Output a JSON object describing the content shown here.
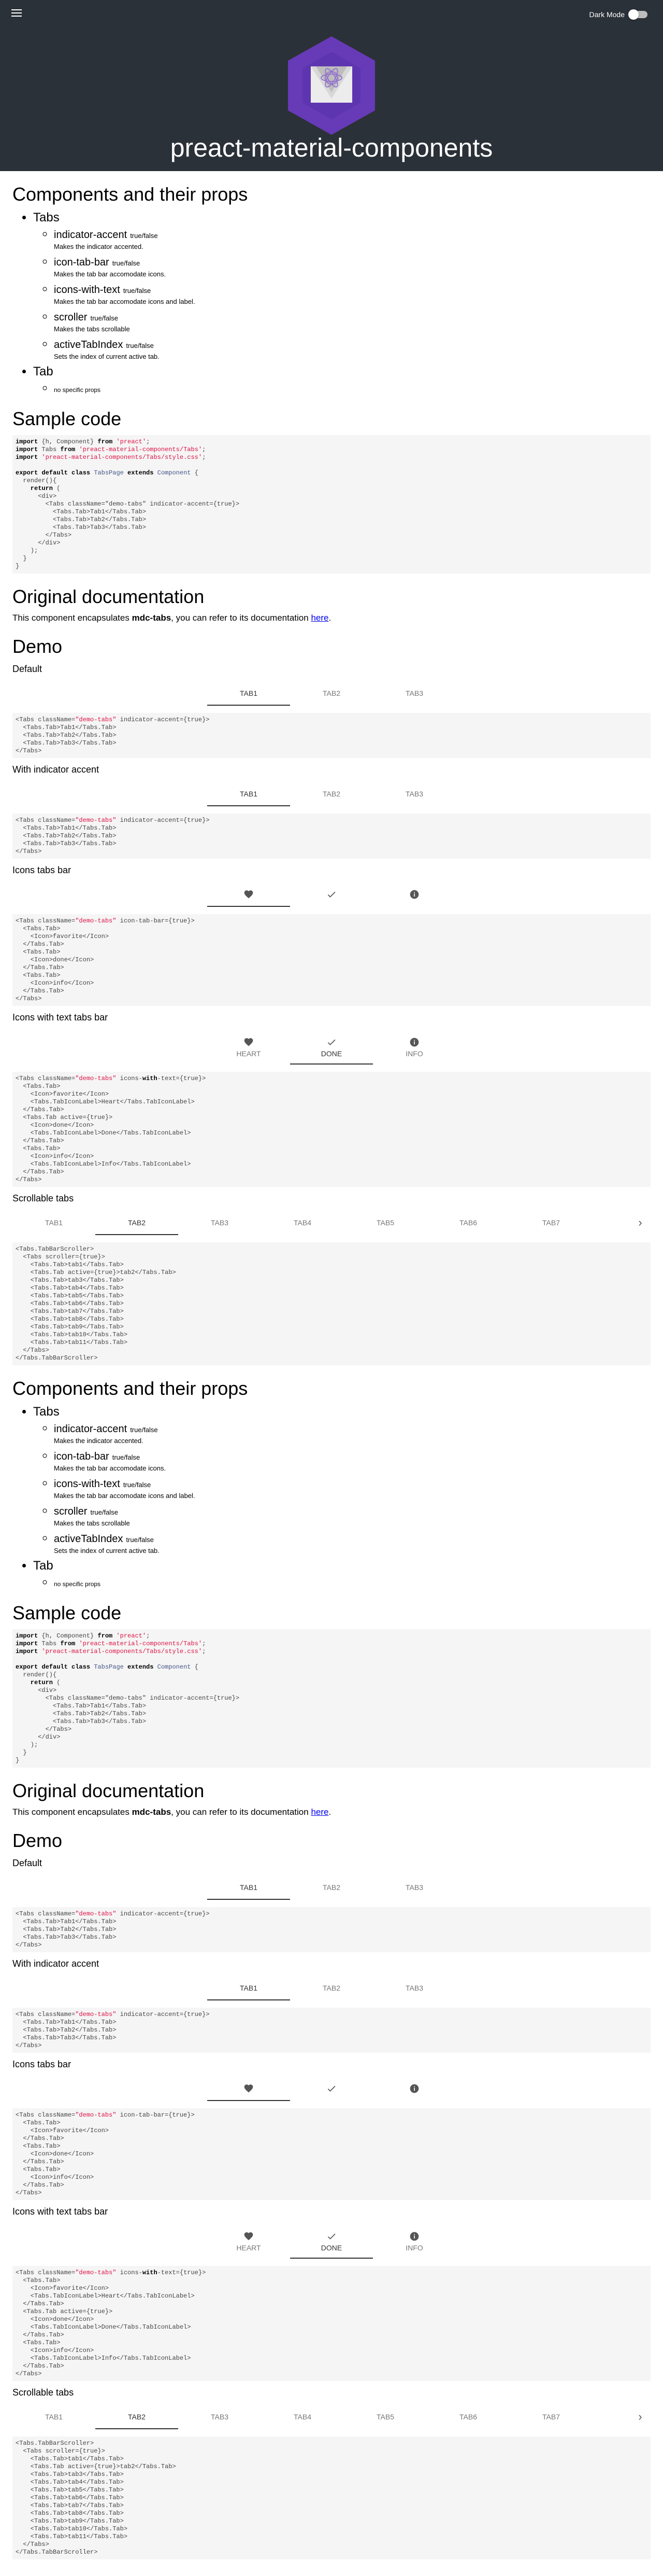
{
  "header": {
    "title": "preact-material-components",
    "dark_mode_label": "Dark Mode",
    "dark_mode_on": false
  },
  "props_section": {
    "title": "Components and their props",
    "components": [
      {
        "name": "Tabs",
        "props": [
          {
            "name": "indicator-accent",
            "type": "true/false",
            "desc": "Makes the indicator accented."
          },
          {
            "name": "icon-tab-bar",
            "type": "true/false",
            "desc": "Makes the tab bar accomodate icons."
          },
          {
            "name": "icons-with-text",
            "type": "true/false",
            "desc": "Makes the tab bar accomodate icons and label."
          },
          {
            "name": "scroller",
            "type": "true/false",
            "desc": "Makes the tabs scrollable"
          },
          {
            "name": "activeTabIndex",
            "type": "true/false",
            "desc": "Sets the index of current active tab."
          }
        ]
      },
      {
        "name": "Tab",
        "no_props": "no specific props"
      }
    ]
  },
  "sample_code": {
    "title": "Sample code"
  },
  "original_doc": {
    "title": "Original documentation",
    "text_before": "This component encapsulates ",
    "component": "mdc-tabs",
    "text_after": ", you can refer to its documentation ",
    "link": "here",
    "period": "."
  },
  "demo": {
    "title": "Demo",
    "default_title": "Default",
    "indicator_title": "With indicator accent",
    "icons_title": "Icons tabs bar",
    "icons_text_title": "Icons with text tabs bar",
    "scroll_title": "Scrollable tabs",
    "basic_tabs": [
      "TAB1",
      "TAB2",
      "TAB3"
    ],
    "icon_tabs": [
      "heart-icon",
      "check-icon",
      "info-icon"
    ],
    "icon_text_tabs": [
      {
        "icon": "heart-icon",
        "label": "HEART"
      },
      {
        "icon": "check-icon",
        "label": "DONE"
      },
      {
        "icon": "info-icon",
        "label": "INFO"
      }
    ],
    "scroll_tabs": [
      "TAB1",
      "TAB2",
      "TAB3",
      "TAB4",
      "TAB5",
      "TAB6",
      "TAB7"
    ],
    "scroll_arrow": "›"
  },
  "colors": {
    "header_bg": "#2b3138",
    "logo_hex": "#673ab7",
    "code_bg": "#f5f5f5"
  }
}
